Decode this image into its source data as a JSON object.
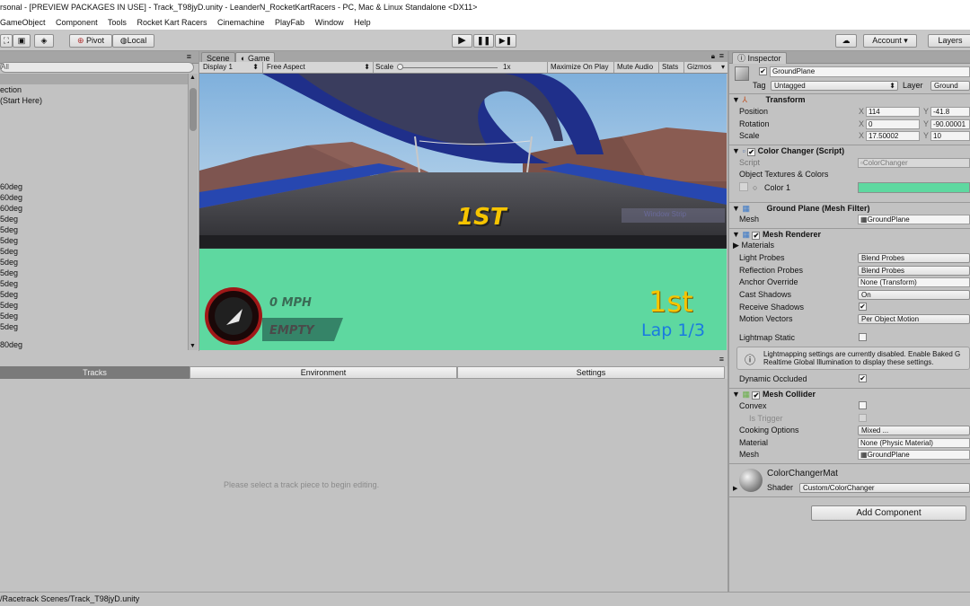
{
  "window": {
    "title": "rsonal - [PREVIEW PACKAGES IN USE] - Track_T98jyD.unity - LeanderN_RocketKartRacers - PC, Mac & Linux Standalone <DX11>"
  },
  "menu": [
    "GameObject",
    "Component",
    "Tools",
    "Rocket Kart Racers",
    "Cinemachine",
    "PlayFab",
    "Window",
    "Help"
  ],
  "toolbar": {
    "pivot": "Pivot",
    "local": "Local",
    "account": "Account",
    "layers": "Layers"
  },
  "hierarchy": {
    "search_placeholder": "All",
    "rows": [
      "ection",
      "(Start Here)",
      "",
      "",
      "",
      "",
      "",
      "",
      "",
      "60deg",
      "60deg",
      "60deg",
      "5deg",
      "5deg",
      "5deg",
      "5deg",
      "5deg",
      "5deg",
      "5deg",
      "5deg",
      "5deg",
      "5deg",
      "5deg",
      "80deg"
    ]
  },
  "scene_tabs": {
    "scene": "Scene",
    "game": "Game"
  },
  "game_toolbar": {
    "display": "Display 1",
    "aspect": "Free Aspect",
    "scale_label": "Scale",
    "scale_value": "1x",
    "maximize": "Maximize On Play",
    "mute": "Mute Audio",
    "stats": "Stats",
    "gizmos": "Gizmos"
  },
  "game_hud": {
    "position_center": "1ST",
    "speed": "0 MPH",
    "item": "EMPTY",
    "position": "1st",
    "lap": "Lap 1/3",
    "watermark": "Window Strip"
  },
  "bottom_tabs": [
    "Tracks",
    "Environment",
    "Settings"
  ],
  "bottom_message": "Please select a track piece to begin editing.",
  "status_bar": "/Racetrack Scenes/Track_T98jyD.unity",
  "inspector": {
    "tab": "Inspector",
    "object_name": "GroundPlane",
    "tag_label": "Tag",
    "tag_value": "Untagged",
    "layer_label": "Layer",
    "layer_value": "Ground",
    "transform": {
      "title": "Transform",
      "position_label": "Position",
      "position": {
        "x": "114",
        "y": "-41.8"
      },
      "rotation_label": "Rotation",
      "rotation": {
        "x": "0",
        "y": "-90.00001"
      },
      "scale_label": "Scale",
      "scale": {
        "x": "17.50002",
        "y": "10"
      }
    },
    "color_changer": {
      "title": "Color Changer (Script)",
      "script_label": "Script",
      "script_value": "ColorChanger",
      "textures_label": "Object Textures & Colors",
      "color1_label": "Color 1",
      "color1": "#5ed8a0"
    },
    "mesh_filter": {
      "title": "Ground Plane (Mesh Filter)",
      "mesh_label": "Mesh",
      "mesh_value": "GroundPlane"
    },
    "mesh_renderer": {
      "title": "Mesh Renderer",
      "materials_label": "Materials",
      "rows": [
        {
          "label": "Light Probes",
          "value": "Blend Probes"
        },
        {
          "label": "Reflection Probes",
          "value": "Blend Probes"
        },
        {
          "label": "Anchor Override",
          "value": "None (Transform)"
        },
        {
          "label": "Cast Shadows",
          "value": "On"
        },
        {
          "label": "Receive Shadows",
          "value": ""
        },
        {
          "label": "Motion Vectors",
          "value": "Per Object Motion"
        }
      ],
      "lightmap_static_label": "Lightmap Static",
      "info_line1": "Lightmapping settings are currently disabled. Enable Baked G",
      "info_line2": "Realtime Global Illumination to display these settings.",
      "dynamic_occluded_label": "Dynamic Occluded"
    },
    "mesh_collider": {
      "title": "Mesh Collider",
      "convex_label": "Convex",
      "trigger_label": "Is Trigger",
      "cooking_label": "Cooking Options",
      "cooking_value": "Mixed ...",
      "material_label": "Material",
      "material_value": "None (Physic Material)",
      "mesh_label": "Mesh",
      "mesh_value": "GroundPlane"
    },
    "material": {
      "name": "ColorChangerMat",
      "shader_label": "Shader",
      "shader_value": "Custom/ColorChanger"
    },
    "add_component": "Add Component"
  }
}
